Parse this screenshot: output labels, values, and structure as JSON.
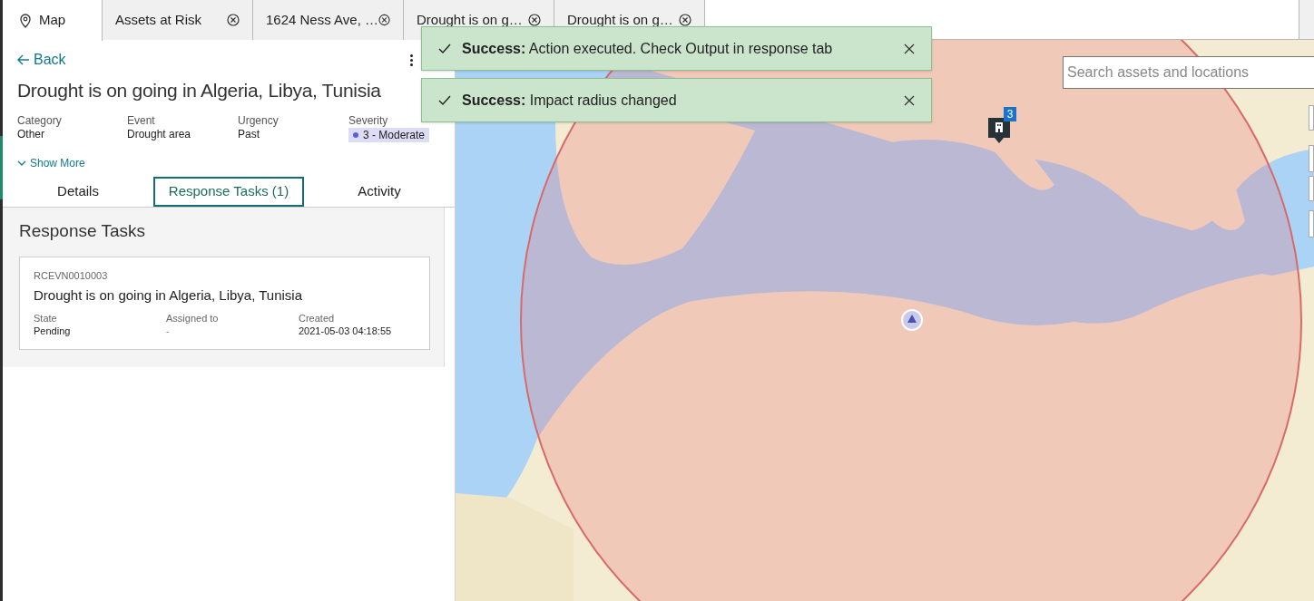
{
  "tabs": [
    {
      "label": "Map",
      "selected": true,
      "closable": false
    },
    {
      "label": "Assets at Risk",
      "selected": false,
      "closable": true
    },
    {
      "label": "1624 Ness Ave, …",
      "selected": false,
      "closable": true
    },
    {
      "label": "Drought is on g…",
      "selected": false,
      "closable": true
    },
    {
      "label": "Drought is on g…",
      "selected": false,
      "closable": true
    }
  ],
  "detail": {
    "back": "Back",
    "title": "Drought is on going in Algeria, Libya, Tunisia",
    "fields": [
      {
        "label": "Category",
        "value": "Other"
      },
      {
        "label": "Event",
        "value": "Drought area"
      },
      {
        "label": "Urgency",
        "value": "Past"
      },
      {
        "label": "Severity",
        "value": "3 - Moderate",
        "kind": "badge",
        "color": "#5a5fd6"
      }
    ],
    "show_more": "Show More",
    "tabs": [
      {
        "label": "Details",
        "selected": false
      },
      {
        "label": "Response Tasks (1)",
        "selected": true
      },
      {
        "label": "Activity",
        "selected": false
      }
    ],
    "section_title": "Response Tasks",
    "task": {
      "number": "RCEVN0010003",
      "title": "Drought is on going in Algeria, Libya, Tunisia",
      "fields": [
        {
          "label": "State",
          "value": "Pending"
        },
        {
          "label": "Assigned to",
          "value": "-"
        },
        {
          "label": "Created",
          "value": "2021-05-03 04:18:55"
        }
      ]
    }
  },
  "toasts": [
    {
      "title": "Success:",
      "message": "Action executed. Check Output in response tab"
    },
    {
      "title": "Success:",
      "message": "Impact radius changed"
    }
  ],
  "map": {
    "search": {
      "placeholder": "Search assets and locations"
    },
    "cluster_count": "3"
  }
}
